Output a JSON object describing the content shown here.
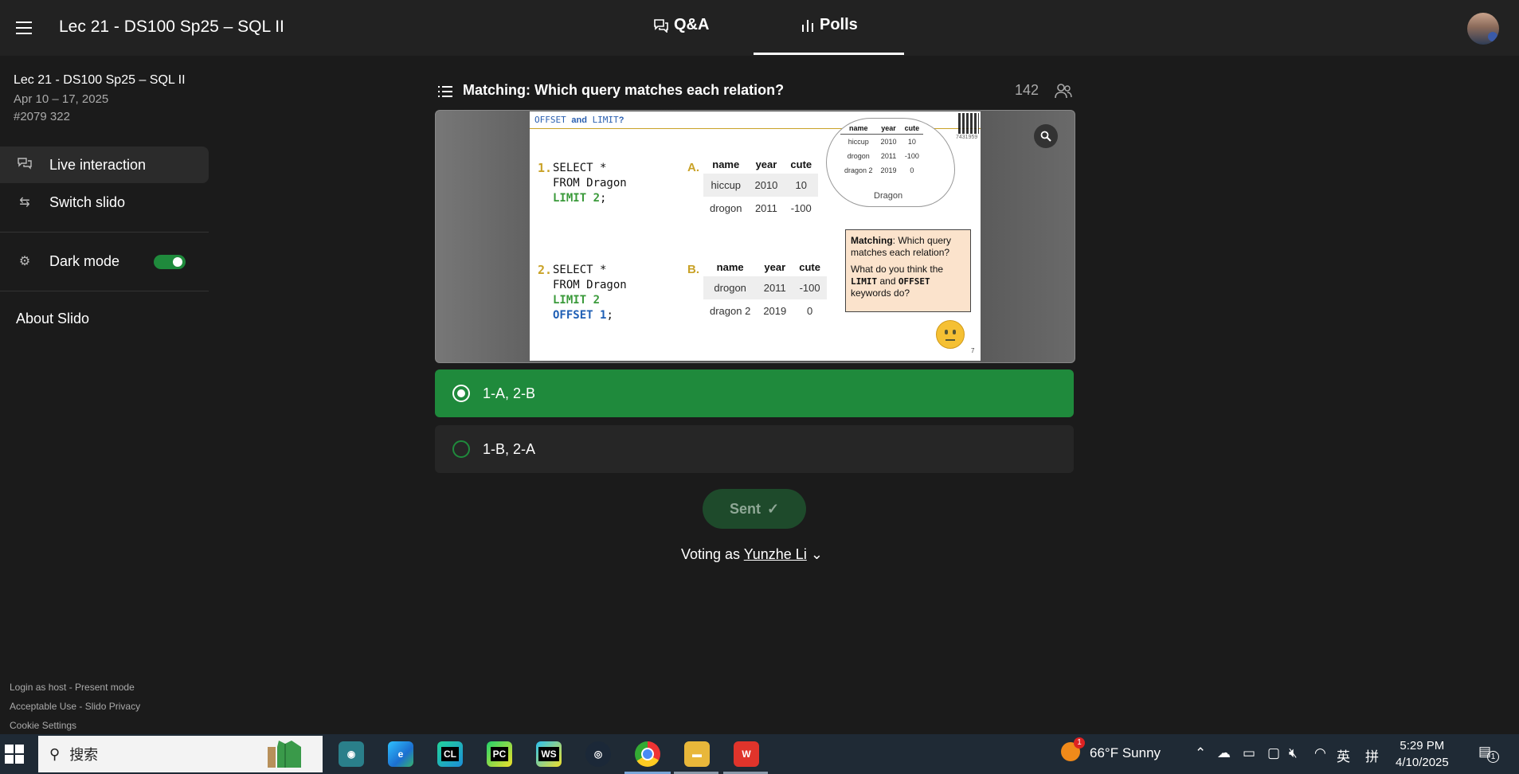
{
  "topbar": {
    "title": "Lec 21 - DS100 Sp25 – SQL II",
    "tabs": [
      {
        "label": "Q&A"
      },
      {
        "label": "Polls"
      }
    ],
    "active_tab": "Polls"
  },
  "sidebar": {
    "event_title": "Lec 21 - DS100 Sp25 – SQL II",
    "event_dates": "Apr 10 – 17, 2025",
    "event_code": "#2079 322",
    "items": [
      {
        "label": "Live interaction"
      },
      {
        "label": "Switch slido"
      },
      {
        "label": "Dark mode"
      },
      {
        "label": "About Slido"
      }
    ],
    "dark_mode_on": true,
    "footer": [
      "Login as host - Present mode",
      "Acceptable Use - Slido Privacy",
      "Cookie Settings"
    ]
  },
  "poll": {
    "question": "Matching: Which query matches each relation?",
    "participants": "142",
    "options": [
      {
        "label": "1-A, 2-B",
        "selected": true
      },
      {
        "label": "1-B, 2-A",
        "selected": false
      }
    ],
    "sent_label": "Sent",
    "voting_prefix": "Voting as",
    "voter_name": "Yunzhe Li"
  },
  "slide": {
    "header_code1": "OFFSET",
    "header_and": "and",
    "header_code2": "LIMIT",
    "header_q": "?",
    "q1_num": "1.",
    "q1_line1": "SELECT *",
    "q1_line2": "FROM Dragon",
    "q1_line3": "LIMIT 2",
    "q1_semi": ";",
    "q2_num": "2.",
    "q2_line1": "SELECT *",
    "q2_line2": "FROM Dragon",
    "q2_line3": "LIMIT 2",
    "q2_line4": "OFFSET 1",
    "q2_semi": ";",
    "letter_a": "A.",
    "letter_b": "B.",
    "table_headers": [
      "name",
      "year",
      "cute"
    ],
    "table_a": [
      [
        "hiccup",
        "2010",
        "10"
      ],
      [
        "drogon",
        "2011",
        "-100"
      ]
    ],
    "table_b": [
      [
        "drogon",
        "2011",
        "-100"
      ],
      [
        "dragon 2",
        "2019",
        "0"
      ]
    ],
    "dragon_table": [
      [
        "hiccup",
        "2010",
        "10"
      ],
      [
        "drogon",
        "2011",
        "-100"
      ],
      [
        "dragon 2",
        "2019",
        "0"
      ]
    ],
    "dragon_label": "Dragon",
    "qr_number": "7431959",
    "note_bold": "Matching",
    "note_line1": ": Which query matches each relation?",
    "note_line2a": "What do you think the",
    "note_kw1": "LIMIT",
    "note_and": "and",
    "note_kw2": "OFFSET",
    "note_line2b": "keywords do?",
    "page_number": "7"
  },
  "taskbar": {
    "search_placeholder": "搜索",
    "apps": [
      "CL",
      "PC",
      "WS"
    ],
    "weather": "66°F  Sunny",
    "weather_badge": "1",
    "ime_lang": "英",
    "ime_mode": "拼",
    "time": "5:29 PM",
    "date": "4/10/2025",
    "notif_count": "1"
  },
  "colors": {
    "accent_green": "#1f8a3c",
    "background": "#1b1b1b",
    "slide_gold": "#c9a227",
    "slide_code_green": "#3a9a3a",
    "slide_code_blue": "#1f5fb5"
  }
}
